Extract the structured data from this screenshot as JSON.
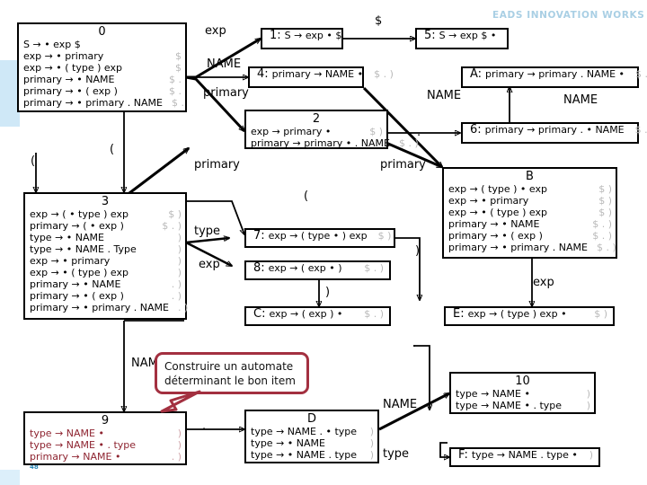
{
  "slide": {
    "logo_text": "EADS INNOVATION WORKS",
    "page_number": "48"
  },
  "callout": {
    "line1": "Construire un automate",
    "line2": "déterminant le bon item",
    "border_color": "#a33040"
  },
  "states": [
    {
      "id": "0",
      "title": "0",
      "items": [
        {
          "prod": "S → • exp $",
          "look": ""
        },
        {
          "prod": "exp → • primary",
          "look": "$"
        },
        {
          "prod": "exp → • ( type ) exp",
          "look": "$"
        },
        {
          "prod": "primary → • NAME",
          "look": "$ ."
        },
        {
          "prod": "primary → • ( exp )",
          "look": "$ ."
        },
        {
          "prod": "primary → • primary . NAME",
          "look": "$ ."
        }
      ]
    },
    {
      "id": "1",
      "label": "1:",
      "prod": "S → exp • $",
      "look": ""
    },
    {
      "id": "5",
      "label": "5:",
      "prod": "S → exp $ •",
      "look": ""
    },
    {
      "id": "4",
      "label": "4:",
      "prod": "primary → NAME •",
      "look": "$ . )"
    },
    {
      "id": "A",
      "label": "A:",
      "prod": "primary → primary . NAME •",
      "look": "$ . )"
    },
    {
      "id": "2",
      "title": "2",
      "items": [
        {
          "prod": "exp → primary •",
          "look": "$ )"
        },
        {
          "prod": "primary → primary • . NAME",
          "look": "$ . )"
        }
      ]
    },
    {
      "id": "6",
      "label": "6:",
      "prod": "primary → primary . • NAME",
      "look": "$ . )"
    },
    {
      "id": "3",
      "title": "3",
      "items": [
        {
          "prod": "exp → ( • type ) exp",
          "look": "$ )"
        },
        {
          "prod": "primary → ( • exp )",
          "look": "$ . )"
        },
        {
          "prod": "type → • NAME",
          "look": ")"
        },
        {
          "prod": "type → • NAME . Type",
          "look": ")"
        },
        {
          "prod": "exp → • primary",
          "look": ")"
        },
        {
          "prod": "exp → • ( type ) exp",
          "look": ")"
        },
        {
          "prod": "primary → • NAME",
          "look": ". )"
        },
        {
          "prod": "primary → • ( exp )",
          "look": ". )"
        },
        {
          "prod": "primary → • primary . NAME",
          "look": ". )"
        }
      ]
    },
    {
      "id": "B",
      "title": "B",
      "items": [
        {
          "prod": "exp → ( type ) • exp",
          "look": "$ )"
        },
        {
          "prod": "exp → • primary",
          "look": "$ )"
        },
        {
          "prod": "exp → • ( type ) exp",
          "look": "$ )"
        },
        {
          "prod": "primary → • NAME",
          "look": "$ . )"
        },
        {
          "prod": "primary → • ( exp )",
          "look": "$ . )"
        },
        {
          "prod": "primary → • primary . NAME",
          "look": "$ . )"
        }
      ]
    },
    {
      "id": "7",
      "label": "7:",
      "prod": "exp → ( type • ) exp",
      "look": "$ )"
    },
    {
      "id": "8",
      "label": "8:",
      "prod": "exp → ( exp • )",
      "look": "$ . )"
    },
    {
      "id": "C",
      "label": "C:",
      "prod": "exp → ( exp ) •",
      "look": "$ . )"
    },
    {
      "id": "E",
      "label": "E:",
      "prod": "exp → ( type ) exp •",
      "look": "$ )"
    },
    {
      "id": "9",
      "title": "9",
      "red": true,
      "items": [
        {
          "prod": "type → NAME •",
          "look": ")"
        },
        {
          "prod": "type → NAME • . type",
          "look": ")"
        },
        {
          "prod": "primary → NAME •",
          "look": ". )"
        }
      ]
    },
    {
      "id": "D",
      "title": "D",
      "items": [
        {
          "prod": "type → NAME . • type",
          "look": ")"
        },
        {
          "prod": "type → • NAME",
          "look": ")"
        },
        {
          "prod": "type → • NAME . type",
          "look": ")"
        }
      ]
    },
    {
      "id": "10",
      "title": "10",
      "items": [
        {
          "prod": "type → NAME •",
          "look": ")"
        },
        {
          "prod": "type → NAME • . type",
          "look": ")"
        }
      ]
    },
    {
      "id": "F",
      "label": "F:",
      "prod": "type → NAME . type •",
      "look": ")"
    }
  ],
  "edge_labels": {
    "exp_0_1": "exp",
    "dollar_1_5": "$",
    "name_0_4": "NAME",
    "primary_0_2": "primary",
    "lparen_0_3a": "(",
    "lparen_0_3b": "(",
    "dot_2_6": ".",
    "name_6_A": "NAME",
    "name_4_B": "NAME",
    "primary_2_B": "primary",
    "primary_3_2": "primary",
    "lparen_3_mid": "(",
    "type_3_7": "type",
    "exp_3_8": "exp",
    "rparen_7_E": ")",
    "rparen_8_C": ")",
    "exp_B_E": "exp",
    "name_3_9": "NAME",
    "dot_9_D": ".",
    "dot_C_D": ".",
    "name_D_10": "NAME",
    "type_10_F": "type"
  }
}
